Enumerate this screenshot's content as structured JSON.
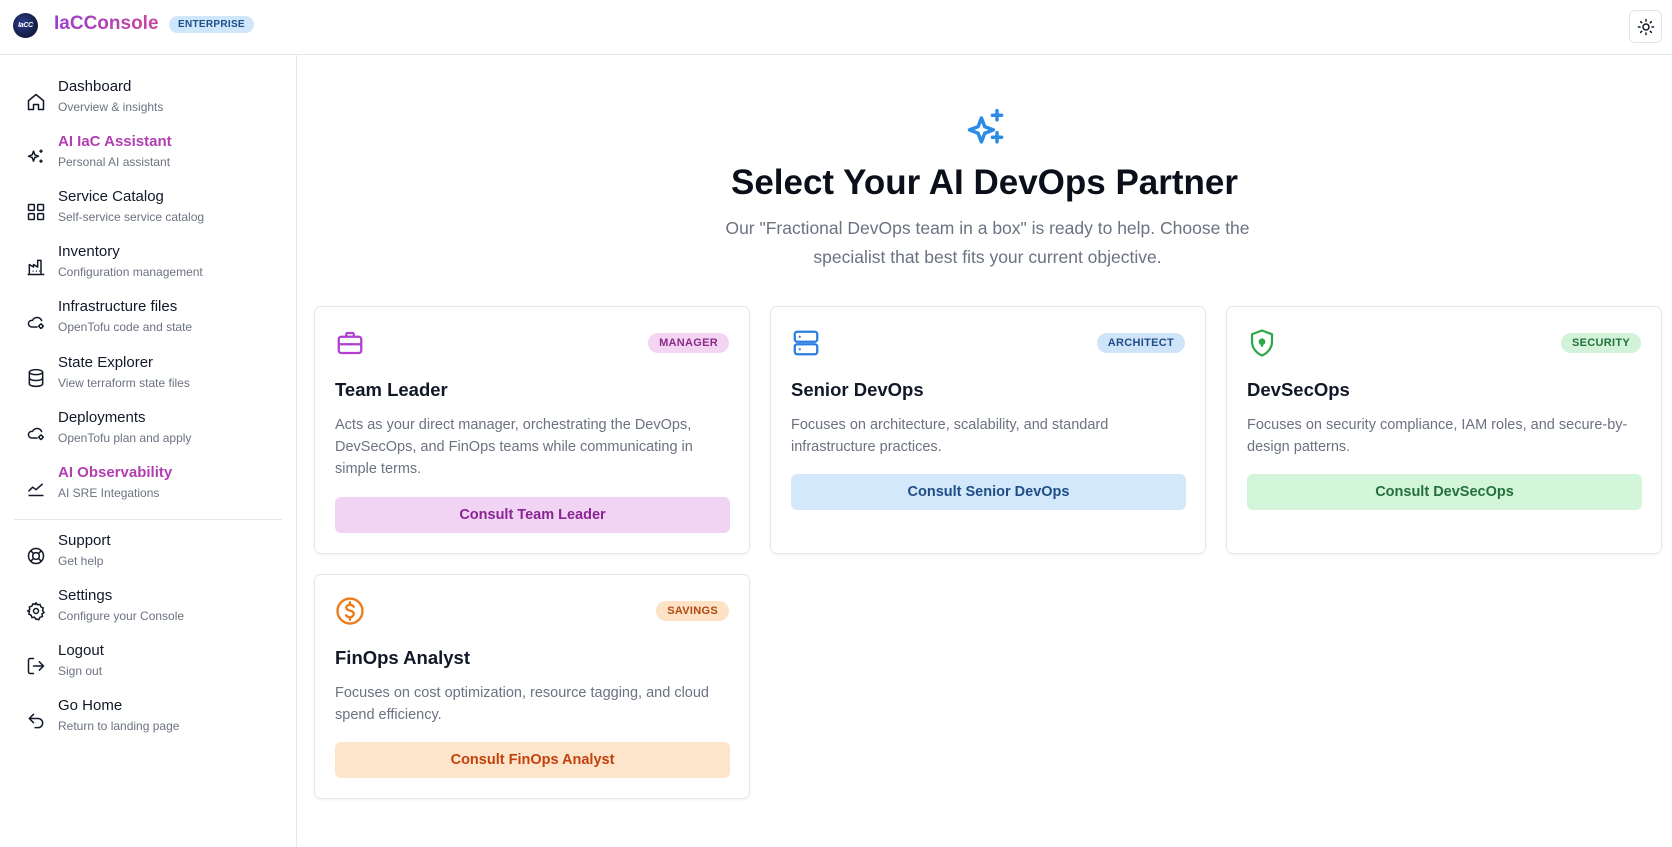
{
  "header": {
    "logo_text": "IaCC",
    "brand": "IaCConsole",
    "edition": "ENTERPRISE"
  },
  "sidebar": {
    "items": [
      {
        "title": "Dashboard",
        "subtitle": "Overview & insights"
      },
      {
        "title": "AI IaC Assistant",
        "subtitle": "Personal AI assistant"
      },
      {
        "title": "Service Catalog",
        "subtitle": "Self-service service catalog"
      },
      {
        "title": "Inventory",
        "subtitle": "Configuration management"
      },
      {
        "title": "Infrastructure files",
        "subtitle": "OpenTofu code and state"
      },
      {
        "title": "State Explorer",
        "subtitle": "View terraform state files"
      },
      {
        "title": "Deployments",
        "subtitle": "OpenTofu plan and apply"
      },
      {
        "title": "AI Observability",
        "subtitle": "AI SRE Integations"
      }
    ],
    "bottom_items": [
      {
        "title": "Support",
        "subtitle": "Get help"
      },
      {
        "title": "Settings",
        "subtitle": "Configure your Console"
      },
      {
        "title": "Logout",
        "subtitle": "Sign out"
      },
      {
        "title": "Go Home",
        "subtitle": "Return to landing page"
      }
    ]
  },
  "main": {
    "title": "Select Your AI DevOps Partner",
    "description": "Our \"Fractional DevOps team in a box\" is ready to help. Choose the specialist that best fits your current objective.",
    "cards": [
      {
        "title": "Team Leader",
        "badge": "MANAGER",
        "description": "Acts as your direct manager, orchestrating the DevOps, DevSecOps, and FinOps teams while communicating in simple terms.",
        "button": "Consult Team Leader"
      },
      {
        "title": "Senior DevOps",
        "badge": "ARCHITECT",
        "description": "Focuses on architecture, scalability, and standard infrastructure practices.",
        "button": "Consult Senior DevOps"
      },
      {
        "title": "DevSecOps",
        "badge": "SECURITY",
        "description": "Focuses on security compliance, IAM roles, and secure-by-design patterns.",
        "button": "Consult DevSecOps"
      },
      {
        "title": "FinOps Analyst",
        "badge": "SAVINGS",
        "description": "Focuses on cost optimization, resource tagging, and cloud spend efficiency.",
        "button": "Consult FinOps Analyst"
      }
    ]
  },
  "colors": {
    "accent": "#b13fb0",
    "manager": "#c026d3",
    "architect": "#2563eb",
    "security": "#16a34a",
    "savings": "#ea580c"
  }
}
